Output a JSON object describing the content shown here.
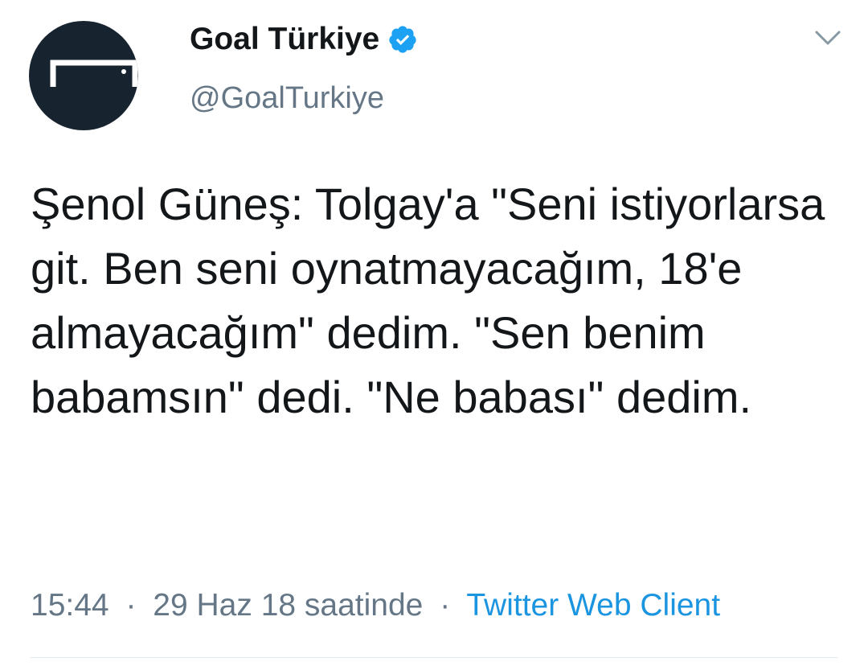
{
  "tweet": {
    "author": {
      "display_name": "Goal Türkiye",
      "handle": "@GoalTurkiye",
      "verified": true,
      "avatar_icon": "goal-logo-icon",
      "verified_icon": "verified-badge-icon"
    },
    "menu_icon": "chevron-down-icon",
    "text": "Şenol Güneş: Tolgay'a \"Seni istiyorlarsa git. Ben seni oynatmayacağım, 18'e almayacağım\" dedim. \"Sen benim babamsın\" dedi. \"Ne babası\" dedim.",
    "meta": {
      "time": "15:44",
      "separator": "·",
      "date": "29 Haz 18 saatinde",
      "client": "Twitter Web Client"
    }
  },
  "colors": {
    "text_primary": "#14171a",
    "text_secondary": "#657786",
    "link_blue": "#1b95e0",
    "verified_blue": "#1da1f2",
    "avatar_bg": "#17232f",
    "divider": "#e1e8ed"
  }
}
